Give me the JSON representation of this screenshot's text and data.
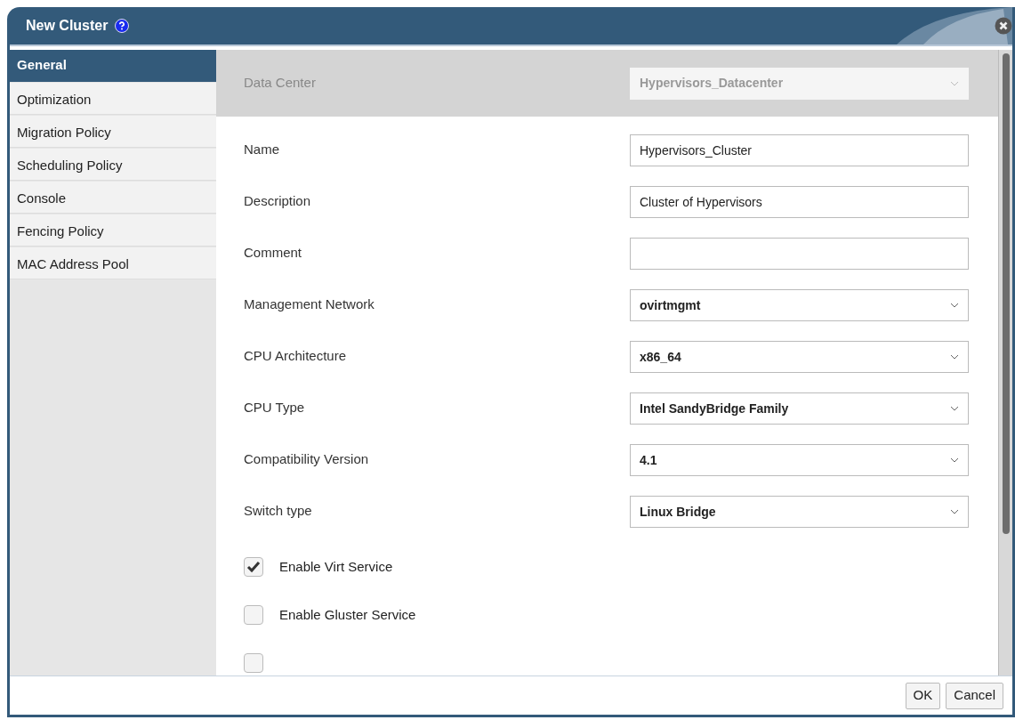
{
  "window": {
    "title": "New Cluster"
  },
  "sidebar": {
    "items": [
      {
        "label": "General",
        "selected": true
      },
      {
        "label": "Optimization",
        "selected": false
      },
      {
        "label": "Migration Policy",
        "selected": false
      },
      {
        "label": "Scheduling Policy",
        "selected": false
      },
      {
        "label": "Console",
        "selected": false
      },
      {
        "label": "Fencing Policy",
        "selected": false
      },
      {
        "label": "MAC Address Pool",
        "selected": false
      }
    ]
  },
  "header_field": {
    "label": "Data Center",
    "kind": "select",
    "value": "Hypervisors_Datacenter",
    "disabled": true
  },
  "fields": [
    {
      "label": "Name",
      "kind": "text",
      "value": "Hypervisors_Cluster"
    },
    {
      "label": "Description",
      "kind": "text",
      "value": "Cluster of Hypervisors"
    },
    {
      "label": "Comment",
      "kind": "text"
    },
    {
      "label": "Management Network",
      "kind": "select",
      "value": "ovirtmgmt"
    },
    {
      "label": "CPU Architecture",
      "kind": "select",
      "value": "x86_64"
    },
    {
      "label": "CPU Type",
      "kind": "select",
      "value": "Intel SandyBridge Family"
    },
    {
      "label": "Compatibility Version",
      "kind": "select",
      "value": "4.1"
    },
    {
      "label": "Switch type",
      "kind": "select",
      "value": "Linux Bridge"
    }
  ],
  "checkboxes": [
    {
      "label": "Enable Virt Service",
      "checked": true
    },
    {
      "label": "Enable Gluster Service",
      "checked": false
    },
    {
      "checked": false
    }
  ],
  "buttons": [
    "OK",
    "Cancel"
  ]
}
